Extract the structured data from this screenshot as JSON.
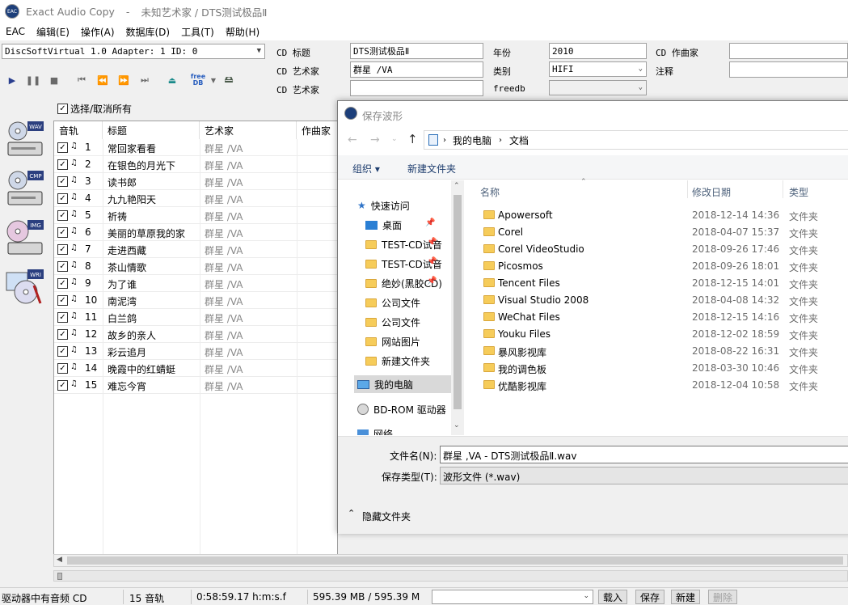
{
  "window": {
    "title": "Exact Audio Copy",
    "separator": "-",
    "subtitle": "未知艺术家 / DTS测试极品Ⅱ",
    "app_icon_text": "EAC"
  },
  "menu": [
    "EAC",
    "编辑(E)",
    "操作(A)",
    "数据库(D)",
    "工具(T)",
    "帮助(H)"
  ],
  "drive": {
    "selected": "DiscSoftVirtual 1.0   Adapter: 1  ID: 0"
  },
  "cd_info": {
    "title_label": "CD 标题",
    "title_value": "DTS测试极品Ⅱ",
    "artist_label": "CD 艺术家",
    "artist_value": "群星 /VA",
    "artist2_label": "CD 艺术家",
    "artist2_value": "",
    "year_label": "年份",
    "year_value": "2010",
    "genre_label": "类别",
    "genre_value": "HIFI",
    "freedb_label": "freedb",
    "freedb_value": "",
    "composer_label": "CD 作曲家",
    "composer_value": "",
    "comment_label": "注释",
    "comment_value": ""
  },
  "toolbar": {
    "freedb_text": "free DB"
  },
  "side_labels": [
    "WAV",
    "CMP",
    "IMG",
    "WRI"
  ],
  "select_all": "选择/取消所有",
  "track_columns": [
    "音轨",
    "标题",
    "艺术家",
    "作曲家"
  ],
  "tracks": [
    {
      "no": "1",
      "title": "常回家看看",
      "artist": "群星 /VA"
    },
    {
      "no": "2",
      "title": "在银色的月光下",
      "artist": "群星 /VA"
    },
    {
      "no": "3",
      "title": " 读书郎",
      "artist": "群星 /VA"
    },
    {
      "no": "4",
      "title": "九九艳阳天",
      "artist": "群星 /VA"
    },
    {
      "no": "5",
      "title": "祈祷",
      "artist": "群星 /VA"
    },
    {
      "no": "6",
      "title": "美丽的草原我的家",
      "artist": "群星 /VA"
    },
    {
      "no": "7",
      "title": "走进西藏",
      "artist": "群星 /VA"
    },
    {
      "no": "8",
      "title": "茶山情歌",
      "artist": "群星 /VA"
    },
    {
      "no": "9",
      "title": "为了谁",
      "artist": "群星 /VA"
    },
    {
      "no": "10",
      "title": " 南泥湾",
      "artist": "群星 /VA"
    },
    {
      "no": "11",
      "title": "白兰鸽",
      "artist": "群星 /VA"
    },
    {
      "no": "12",
      "title": "故乡的亲人",
      "artist": "群星 /VA"
    },
    {
      "no": "13",
      "title": "彩云追月",
      "artist": "群星 /VA"
    },
    {
      "no": "14",
      "title": "晚霞中的红蜻蜓",
      "artist": "群星 /VA"
    },
    {
      "no": "15",
      "title": "难忘今宵",
      "artist": "群星 /VA"
    }
  ],
  "dialog": {
    "title": "保存波形",
    "breadcrumb": [
      "我的电脑",
      "文档"
    ],
    "organize": "组织 ▾",
    "new_folder": "新建文件夹",
    "nav": [
      {
        "label": "快速访问",
        "type": "star"
      },
      {
        "label": "桌面",
        "type": "desk",
        "pinned": true
      },
      {
        "label": "TEST-CD试音",
        "type": "folder",
        "pinned": true
      },
      {
        "label": "TEST-CD试音",
        "type": "folder",
        "pinned": true
      },
      {
        "label": "绝妙(黑胶CD)",
        "type": "folder",
        "pinned": true
      },
      {
        "label": "公司文件",
        "type": "folder"
      },
      {
        "label": "公司文件",
        "type": "folder"
      },
      {
        "label": "网站图片",
        "type": "folder"
      },
      {
        "label": "新建文件夹",
        "type": "folder"
      },
      {
        "label": "我的电脑",
        "type": "pc",
        "selected": true
      },
      {
        "label": "BD-ROM 驱动器",
        "type": "disc"
      },
      {
        "label": "网络",
        "type": "net"
      }
    ],
    "columns": {
      "name": "名称",
      "modified": "修改日期",
      "type": "类型"
    },
    "files": [
      {
        "name": "Apowersoft",
        "date": "2018-12-14 14:36",
        "type": "文件夹"
      },
      {
        "name": "Corel",
        "date": "2018-04-07 15:37",
        "type": "文件夹"
      },
      {
        "name": "Corel VideoStudio",
        "date": "2018-09-26 17:46",
        "type": "文件夹"
      },
      {
        "name": "Picosmos",
        "date": "2018-09-26 18:01",
        "type": "文件夹"
      },
      {
        "name": "Tencent Files",
        "date": "2018-12-15 14:01",
        "type": "文件夹"
      },
      {
        "name": "Visual Studio 2008",
        "date": "2018-04-08 14:32",
        "type": "文件夹"
      },
      {
        "name": "WeChat Files",
        "date": "2018-12-15 14:16",
        "type": "文件夹"
      },
      {
        "name": "Youku Files",
        "date": "2018-12-02 18:59",
        "type": "文件夹"
      },
      {
        "name": "暴风影视库",
        "date": "2018-08-22 16:31",
        "type": "文件夹"
      },
      {
        "name": "我的调色板",
        "date": "2018-03-30 10:46",
        "type": "文件夹"
      },
      {
        "name": "优酷影视库",
        "date": "2018-12-04 10:58",
        "type": "文件夹"
      }
    ],
    "filename_label": "文件名(N):",
    "filename_value": "群星 ,VA  - DTS测试极品Ⅱ.wav",
    "savetype_label": "保存类型(T):",
    "savetype_value": "波形文件 (*.wav)",
    "hide_folders": "隐藏文件夹"
  },
  "status": {
    "drive_msg": "驱动器中有音频 CD",
    "tracks": "15 音轨",
    "duration": "0:58:59.17 h:m:s.f",
    "size": "595.39 MB / 595.39 M",
    "load": "载入",
    "save": "保存",
    "new": "新建",
    "delete": "删除"
  }
}
